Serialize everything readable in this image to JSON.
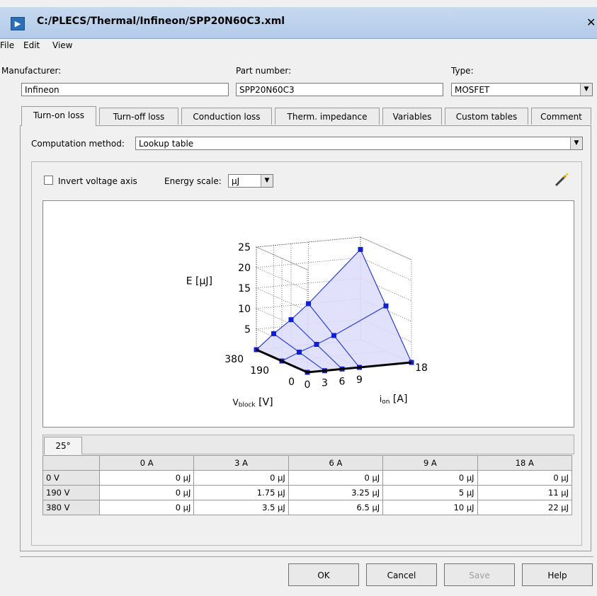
{
  "window": {
    "title": "C:/PLECS/Thermal/Infineon/SPP20N60C3.xml",
    "close_glyph": "✕"
  },
  "menu": [
    "File",
    "Edit",
    "View"
  ],
  "fields": {
    "manufacturer_label": "Manufacturer:",
    "manufacturer_value": "Infineon",
    "part_number_label": "Part number:",
    "part_number_value": "SPP20N60C3",
    "type_label": "Type:",
    "type_value": "MOSFET"
  },
  "tabs": [
    "Turn-on loss",
    "Turn-off loss",
    "Conduction loss",
    "Therm. impedance",
    "Variables",
    "Custom tables",
    "Comment"
  ],
  "active_tab": "Turn-on loss",
  "computation": {
    "label": "Computation method:",
    "value": "Lookup table"
  },
  "options": {
    "invert_label": "Invert voltage axis",
    "invert_checked": false,
    "energy_scale_label": "Energy scale:",
    "energy_scale_value": "μJ"
  },
  "chart_data": {
    "type": "surface3d",
    "z_label": "E [μJ]",
    "z_ticks": [
      "5",
      "10",
      "15",
      "20",
      "25"
    ],
    "v_label_main": "V",
    "v_label_sub": "block",
    "v_label_unit": " [V]",
    "v_ticks": [
      "380",
      "190",
      "0"
    ],
    "i_label_main": "i",
    "i_label_sub": "on",
    "i_label_unit": " [A]",
    "i_ticks": [
      "0",
      "3",
      "6",
      "9",
      "18"
    ],
    "currents": [
      0,
      3,
      6,
      9,
      18
    ],
    "voltages": [
      0,
      190,
      380
    ],
    "energies": [
      [
        0,
        0,
        0,
        0,
        0
      ],
      [
        0,
        1.75,
        3.25,
        5,
        11
      ],
      [
        0,
        3.5,
        6.5,
        10,
        22
      ]
    ],
    "line_color": "#2a3fd8",
    "fill_color": "#dcdcfa"
  },
  "table": {
    "temp_tab": "25°",
    "columns": [
      "0 A",
      "3 A",
      "6 A",
      "9 A",
      "18 A"
    ],
    "rows": [
      {
        "label": "0 V",
        "values": [
          "0 μJ",
          "0 μJ",
          "0 μJ",
          "0 μJ",
          "0 μJ"
        ]
      },
      {
        "label": "190 V",
        "values": [
          "0 μJ",
          "1.75 μJ",
          "3.25 μJ",
          "5 μJ",
          "11 μJ"
        ]
      },
      {
        "label": "380 V",
        "values": [
          "0 μJ",
          "3.5 μJ",
          "6.5 μJ",
          "10 μJ",
          "22 μJ"
        ]
      }
    ]
  },
  "buttons": {
    "ok": "OK",
    "cancel": "Cancel",
    "save": "Save",
    "help": "Help"
  }
}
